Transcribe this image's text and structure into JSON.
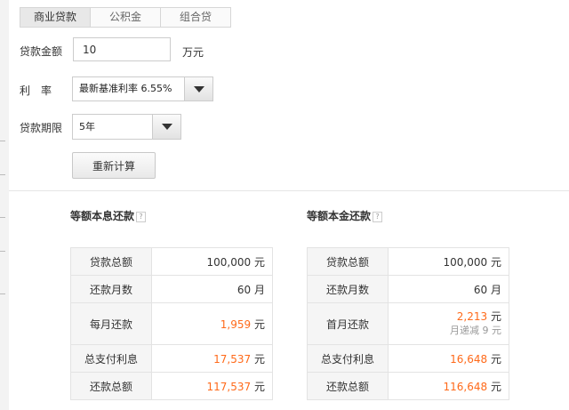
{
  "tabs": [
    {
      "label": "商业贷款",
      "active": true
    },
    {
      "label": "公积金",
      "active": false
    },
    {
      "label": "组合贷",
      "active": false
    }
  ],
  "form": {
    "amount_label": "贷款金额",
    "amount_value": "10",
    "amount_unit": "万元",
    "rate_label": "利　率",
    "rate_value": "最新基准利率 6.55%",
    "term_label": "贷款期限",
    "term_value": "5年",
    "recalc_label": "重新计算"
  },
  "colors": {
    "highlight": "#ff6a1a"
  },
  "results": {
    "equal_payment": {
      "title": "等额本息还款",
      "help_icon": "?",
      "rows": [
        {
          "label": "贷款总额",
          "value": "100,000",
          "unit": "元"
        },
        {
          "label": "还款月数",
          "value": "60",
          "unit": "月"
        },
        {
          "label": "每月还款",
          "value": "1,959",
          "unit": "元"
        },
        {
          "label": "总支付利息",
          "value": "17,537",
          "unit": "元"
        },
        {
          "label": "还款总额",
          "value": "117,537",
          "unit": "元"
        }
      ]
    },
    "equal_principal": {
      "title": "等额本金还款",
      "help_icon": "?",
      "rows": [
        {
          "label": "贷款总额",
          "value": "100,000",
          "unit": "元"
        },
        {
          "label": "还款月数",
          "value": "60",
          "unit": "月"
        },
        {
          "label": "首月还款",
          "value": "2,213",
          "unit": "元",
          "note_label": "月递减",
          "note_value": "9",
          "note_unit": "元"
        },
        {
          "label": "总支付利息",
          "value": "16,648",
          "unit": "元"
        },
        {
          "label": "还款总额",
          "value": "116,648",
          "unit": "元"
        }
      ]
    }
  }
}
